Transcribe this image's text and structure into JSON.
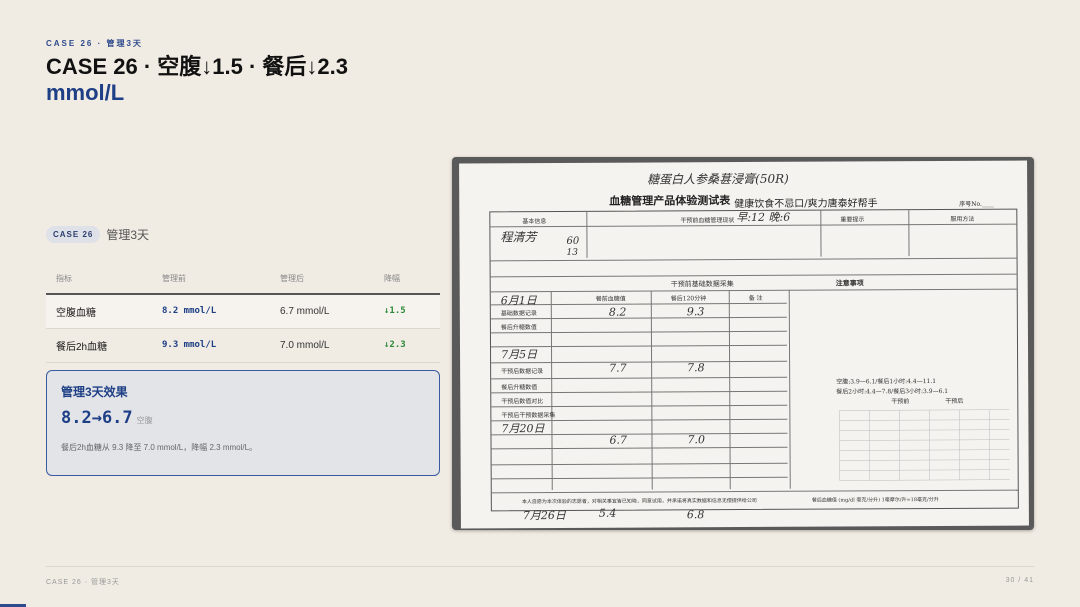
{
  "kicker": "CASE 26 · 管理3天",
  "title": {
    "line1": "CASE 26 · 空腹↓1.5 · 餐后↓2.3",
    "line2": "mmol/L"
  },
  "case_tag": {
    "badge": "CASE 26",
    "label": "管理3天"
  },
  "table": {
    "headers": [
      "指标",
      "管理前",
      "管理后",
      "降幅"
    ],
    "rows": [
      {
        "metric": "空腹血糖",
        "before": "8.2 mmol/L",
        "after": "6.7 mmol/L",
        "drop": "↓1.5"
      },
      {
        "metric": "餐后2h血糖",
        "before": "9.3 mmol/L",
        "after": "7.0 mmol/L",
        "drop": "↓2.3"
      }
    ]
  },
  "effect": {
    "title": "管理3天效果",
    "value": "8.2→6.7",
    "unit": "空腹",
    "desc": "餐后2h血糖从 9.3 降至 7.0 mmol/L，降幅 2.3 mmol/L。"
  },
  "photo": {
    "header_hand": "糖蛋白人参桑葚浸膏(50R)",
    "sub_title": "血糖管理产品体验测试表",
    "slogan": "健康饮食不忌口/爽力唐泰好帮手",
    "serial": "序号No.____",
    "name_hand": "程清芳",
    "age_hand": "60",
    "years_hand": "13",
    "intake_hand": "早:12 晚:6",
    "section_basic": "基本信息",
    "section_pre": "干预前血糖管理现状",
    "section_tips": "重要提示",
    "section_method": "服用方法",
    "notes_title": "注意事项",
    "block_title": "干预前基础数据采集",
    "col_fast": "餐前血糖值",
    "col_post": "餐后120分钟",
    "col_note": "备 注",
    "row1_date": "6月1日",
    "row1_fast": "8.2",
    "row1_post": "9.3",
    "row2_date": "7月5日",
    "row2_fast": "7.7",
    "row2_post": "7.8",
    "row3_date": "7月20日",
    "row3_fast": "6.7",
    "row3_post": "7.0",
    "row4_date": "7月26日",
    "row4_fast": "5.4",
    "row4_post": "6.8",
    "lbl_base": "基础数据记录",
    "lbl_rise": "餐后升糖数值",
    "lbl_after": "干预后数据记录",
    "lbl_after_rise": "餐后升糖数值",
    "lbl_compare": "干预后数值对比",
    "lbl_after_collect": "干预后干预数据采集",
    "ref_fast": "空腹:3.9—6.1/餐后1小时:4.4—11.1",
    "ref_post": "餐后2小时:4.4—7.8/餐后3小时:3.9—6.1",
    "legend_a": "干预前",
    "legend_b": "干预后",
    "footer_note": "本人自愿为本次体验的志愿者，对相关事宜皆已知晓，同意试用，并承诺将真实数据和信息无偿提供给公司",
    "footer_right": "餐后血糖值 (mg/dl 毫克/分升) 1毫摩尔/升=18毫克/分升"
  },
  "footer": {
    "left": "CASE 26 · 管理3天",
    "right": "30 / 41"
  },
  "progress_fraction": 0.024,
  "colors": {
    "accent": "#1e3f86",
    "drop": "#2e8a3a",
    "background": "#f0ebe3"
  }
}
